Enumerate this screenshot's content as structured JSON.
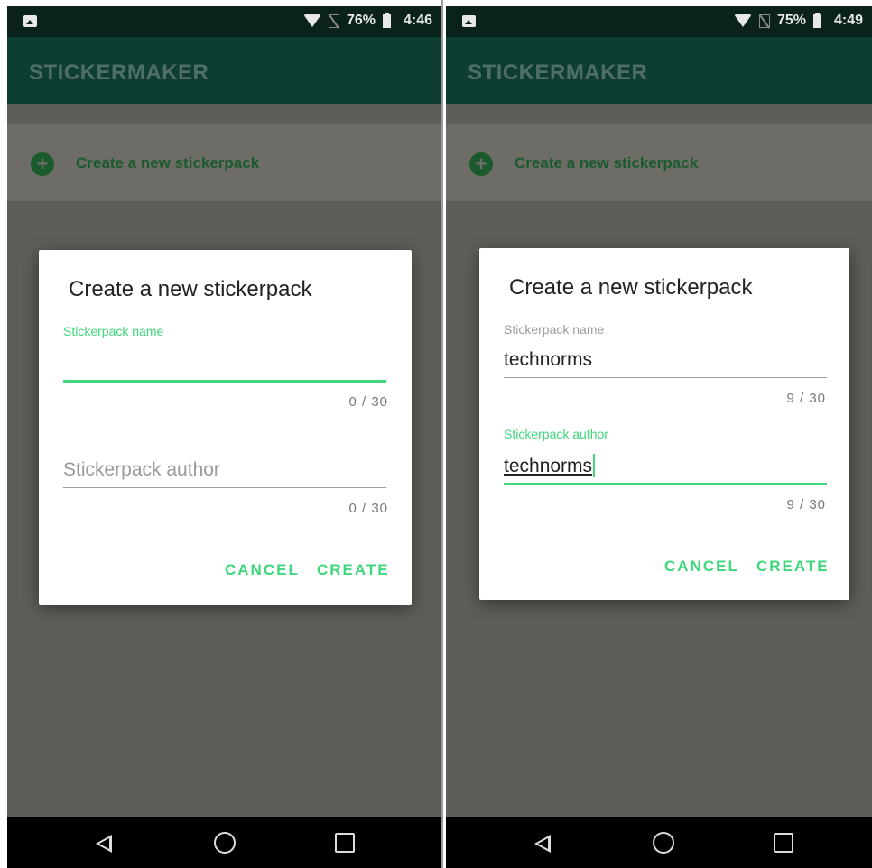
{
  "left": {
    "status": {
      "battery": "76%",
      "time": "4:46"
    },
    "app_title": "STICKERMAKER",
    "list_item": "Create a new stickerpack",
    "dialog": {
      "title": "Create a new stickerpack",
      "name_label": "Stickerpack name",
      "name_value": "",
      "name_counter": "0 / 30",
      "author_placeholder": "Stickerpack author",
      "author_counter": "0 / 30",
      "cancel": "CANCEL",
      "create": "CREATE"
    }
  },
  "right": {
    "status": {
      "battery": "75%",
      "time": "4:49"
    },
    "app_title": "STICKERMAKER",
    "list_item": "Create a new stickerpack",
    "dialog": {
      "title": "Create a new stickerpack",
      "name_label": "Stickerpack name",
      "name_value": "technorms",
      "name_counter": "9 / 30",
      "author_label": "Stickerpack author",
      "author_value": "technorms",
      "author_counter": "9 / 30",
      "cancel": "CANCEL",
      "create": "CREATE"
    }
  },
  "colors": {
    "accent": "#3ed77b",
    "app_bar": "#0e3d33",
    "status_bar": "#0a211c",
    "scrim": "#5e5d58"
  },
  "icons": [
    "image-notification-icon",
    "wifi-icon",
    "sim-icon",
    "battery-icon",
    "add-circle-icon",
    "back-nav-icon",
    "home-nav-icon",
    "recents-nav-icon"
  ]
}
